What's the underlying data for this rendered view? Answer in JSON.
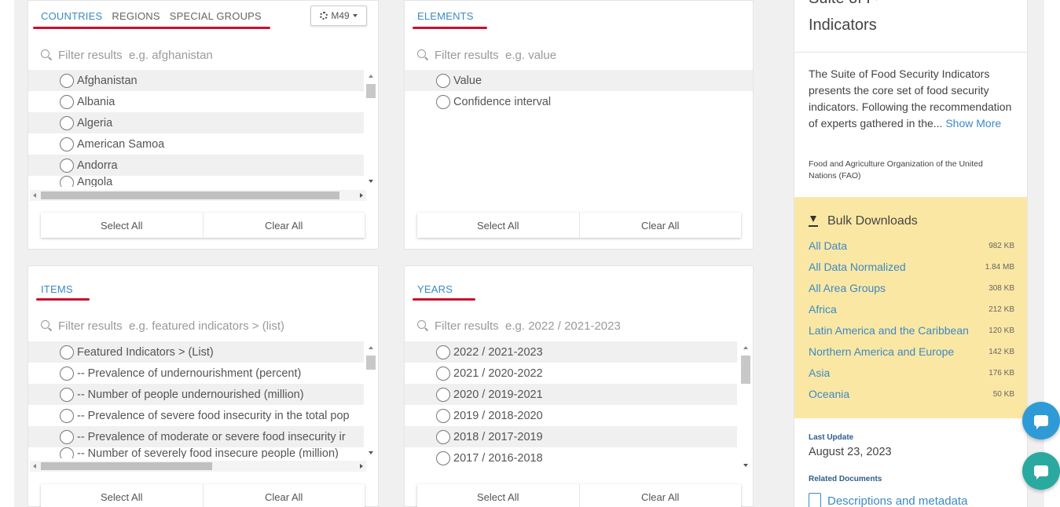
{
  "countries_panel": {
    "tabs": [
      "Countries",
      "Regions",
      "Special Groups"
    ],
    "active_tab": 0,
    "code_selector": "M49",
    "filter_placeholder": "Filter results  e.g. afghanistan",
    "items": [
      "Afghanistan",
      "Albania",
      "Algeria",
      "American Samoa",
      "Andorra",
      "Angola"
    ],
    "select_all": "Select All",
    "clear_all": "Clear All"
  },
  "elements_panel": {
    "tab": "Elements",
    "filter_placeholder": "Filter results  e.g. value",
    "items": [
      "Value",
      "Confidence interval"
    ],
    "select_all": "Select All",
    "clear_all": "Clear All"
  },
  "items_panel": {
    "tab": "Items",
    "filter_placeholder": "Filter results  e.g. featured indicators > (list)",
    "items": [
      "Featured Indicators > (List)",
      "-- Prevalence of undernourishment (percent)",
      "-- Number of people undernourished (million)",
      "-- Prevalence of severe food insecurity in the total pop",
      "-- Prevalence of moderate or severe food insecurity ir",
      "-- Number of severely food insecure people (million)"
    ],
    "select_all": "Select All",
    "clear_all": "Clear All"
  },
  "years_panel": {
    "tab": "Years",
    "filter_placeholder": "Filter results  e.g. 2022 / 2021-2023",
    "items": [
      "2022 / 2021-2023",
      "2021 / 2020-2022",
      "2020 / 2019-2021",
      "2019 / 2018-2020",
      "2018 / 2017-2019",
      "2017 / 2016-2018"
    ],
    "select_all": "Select All",
    "clear_all": "Clear All"
  },
  "sidebar": {
    "title_cut": "Suite of Food Security",
    "title": "Indicators",
    "description": "The Suite of Food Security Indicators presents the core set of food security indicators. Following the recommendation of experts gathered in the...",
    "show_more": "Show More",
    "organization": "Food and Agriculture Organization of the United Nations (FAO)",
    "bulk": {
      "heading": "Bulk Downloads",
      "downloads": [
        {
          "name": "All Data",
          "size": "982 KB"
        },
        {
          "name": "All Data Normalized",
          "size": "1.84 MB"
        },
        {
          "name": "All Area Groups",
          "size": "308 KB"
        },
        {
          "name": "Africa",
          "size": "212 KB"
        },
        {
          "name": "Latin America and the Caribbean",
          "size": "120 KB"
        },
        {
          "name": "Northern America and Europe",
          "size": "142 KB"
        },
        {
          "name": "Asia",
          "size": "176 KB"
        },
        {
          "name": "Oceania",
          "size": "50 KB"
        }
      ]
    },
    "last_update_label": "Last Update",
    "last_update": "August 23, 2023",
    "related_label": "Related Documents",
    "related_doc": "Descriptions and metadata"
  },
  "colors": {
    "accent": "#3b8ac4",
    "underline": "#c8102e",
    "bulk_bg": "#fbe7a4",
    "fab_chat": "#2e9bd6",
    "fab_feedback": "#2aa9a0"
  }
}
